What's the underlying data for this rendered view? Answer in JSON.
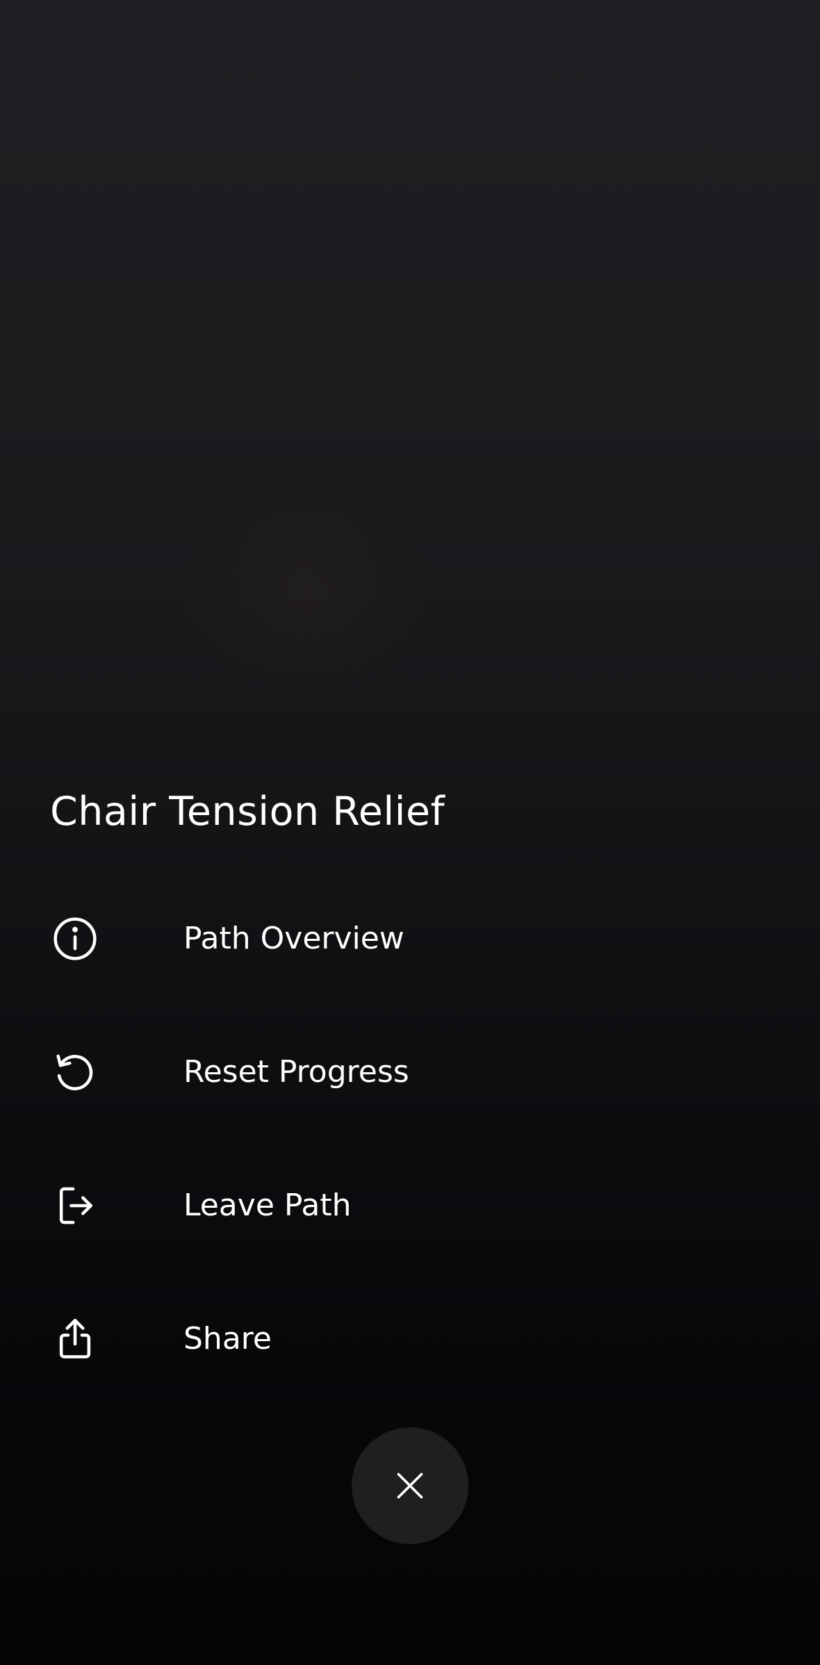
{
  "menu": {
    "title": "Chair Tension Relief",
    "items": [
      {
        "label": "Path Overview",
        "icon": "info-icon"
      },
      {
        "label": "Reset Progress",
        "icon": "reset-icon"
      },
      {
        "label": "Leave Path",
        "icon": "exit-icon"
      },
      {
        "label": "Share",
        "icon": "share-icon"
      }
    ]
  },
  "close": {
    "icon": "close-icon"
  },
  "colors": {
    "background_top": "#1f1e22",
    "background_bottom": "#050406",
    "text": "#ffffff",
    "close_button_bg": "#1f1e21"
  }
}
